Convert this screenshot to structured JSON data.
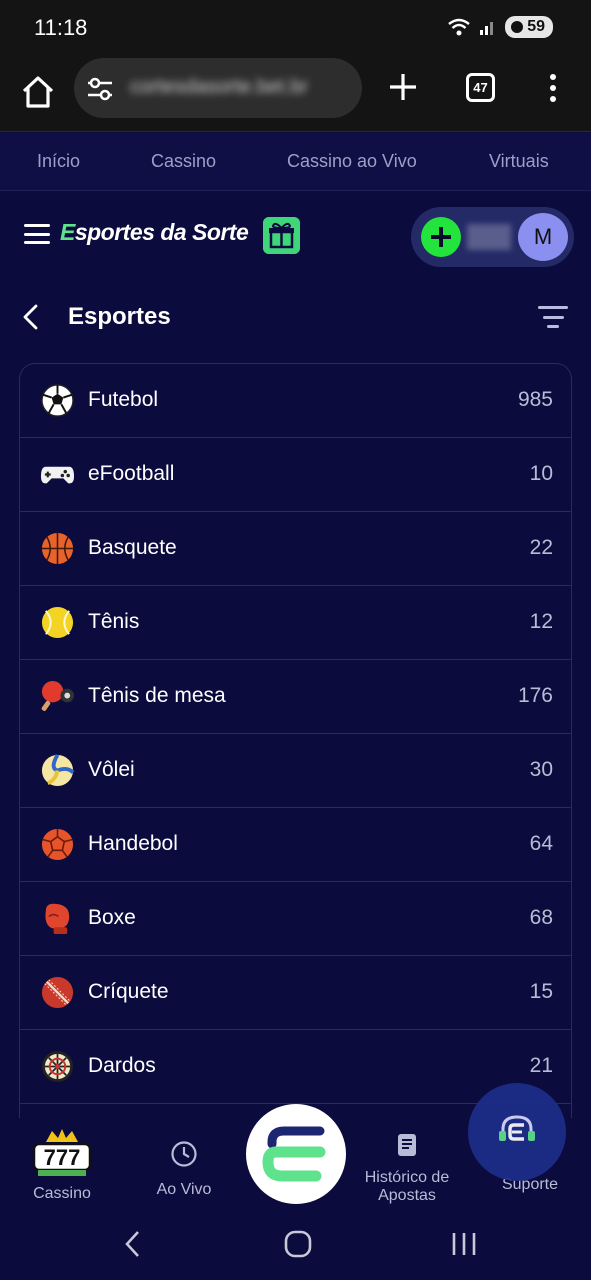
{
  "status_bar": {
    "time": "11:18",
    "battery": "59"
  },
  "browser": {
    "url": "cortesdasorte.bet.br",
    "tab_count": "47"
  },
  "site_nav": {
    "items": [
      "Início",
      "Cassino",
      "Cassino ao Vivo",
      "Virtuais"
    ]
  },
  "header": {
    "logo_main": "sportes",
    "logo_prefix": "E",
    "logo_suffix": "da Sorte",
    "balance": "R$",
    "avatar_initial": "M"
  },
  "section": {
    "title": "Esportes"
  },
  "sports": [
    {
      "name": "Futebol",
      "count": "985",
      "icon": "soccer-ball-icon"
    },
    {
      "name": "eFootball",
      "count": "10",
      "icon": "gamepad-icon"
    },
    {
      "name": "Basquete",
      "count": "22",
      "icon": "basketball-icon"
    },
    {
      "name": "Tênis",
      "count": "12",
      "icon": "tennis-ball-icon"
    },
    {
      "name": "Tênis de mesa",
      "count": "176",
      "icon": "ping-pong-icon"
    },
    {
      "name": "Vôlei",
      "count": "30",
      "icon": "volleyball-icon"
    },
    {
      "name": "Handebol",
      "count": "64",
      "icon": "handball-icon"
    },
    {
      "name": "Boxe",
      "count": "68",
      "icon": "boxing-glove-icon"
    },
    {
      "name": "Críquete",
      "count": "15",
      "icon": "cricket-ball-icon"
    },
    {
      "name": "Dardos",
      "count": "21",
      "icon": "dartboard-icon"
    }
  ],
  "bottom_nav": {
    "cassino": "Cassino",
    "ao_vivo": "Ao Vivo",
    "historico_line1": "Histórico de",
    "historico_line2": "Apostas",
    "suporte": "Suporte"
  },
  "colors": {
    "background": "#0b0b3d",
    "accent_green": "#22e43c",
    "avatar": "#8a8ff0"
  }
}
